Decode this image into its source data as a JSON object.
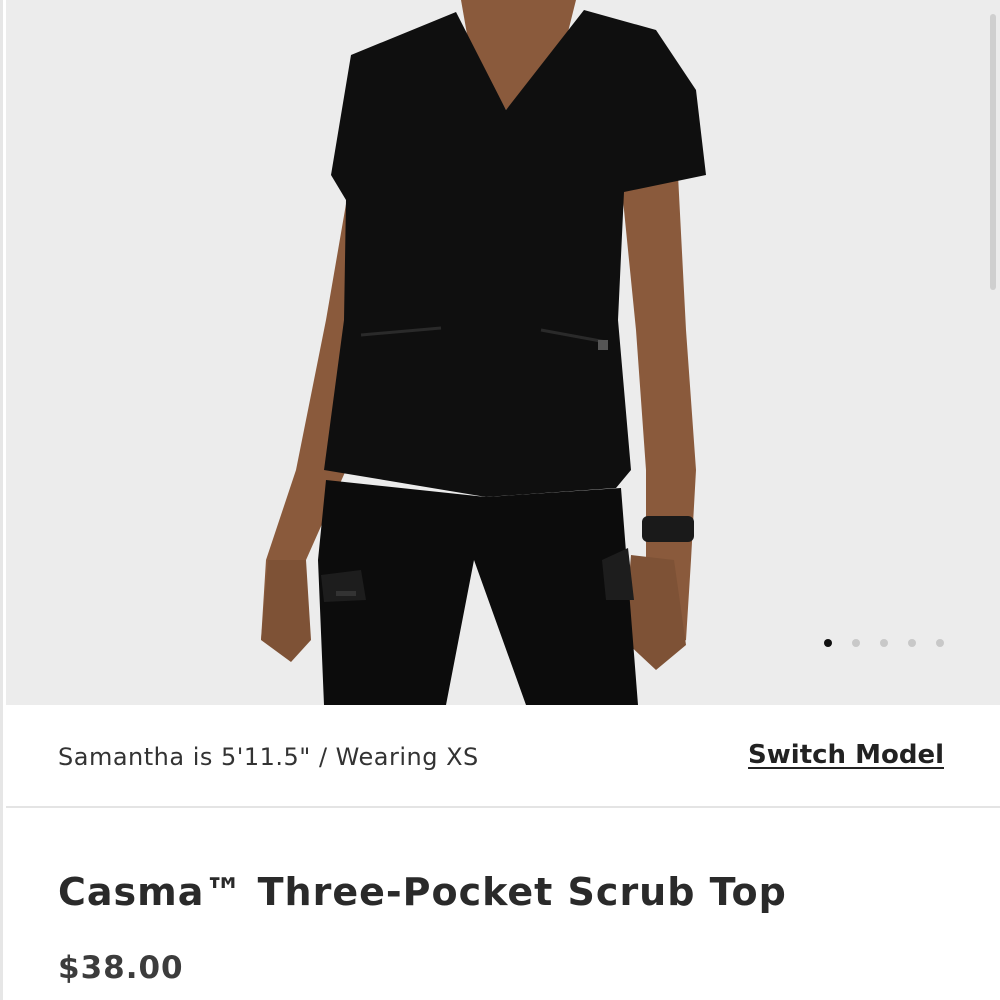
{
  "product": {
    "title": "Casma™ Three-Pocket Scrub Top",
    "price": "$38.00",
    "image_alt": "model-wearing-black-scrub-top"
  },
  "model_info": {
    "text": "Samantha is 5'11.5\" / Wearing XS",
    "switch_label": "Switch Model"
  },
  "carousel": {
    "total": 5,
    "active_index": 0
  },
  "colors": {
    "background": "#ececec",
    "garment": "#0f0f0f",
    "skin": "#8a5a3c"
  }
}
